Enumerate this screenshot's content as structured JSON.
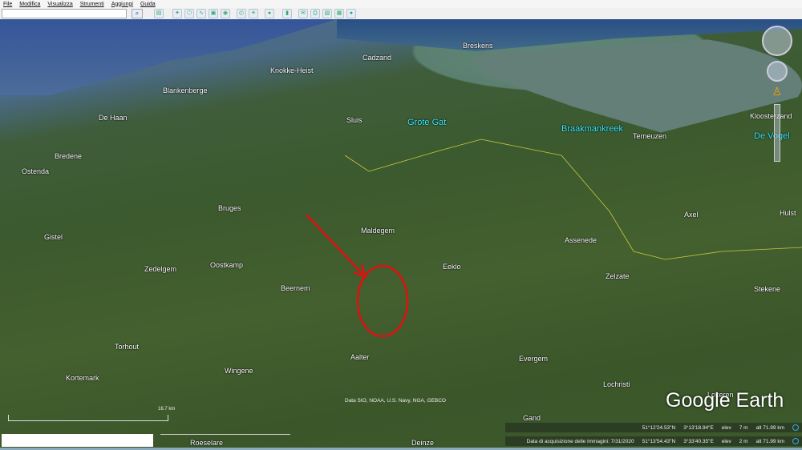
{
  "menu": [
    "File",
    "Modifica",
    "Visualizza",
    "Strumenti",
    "Aggiungi",
    "Guida"
  ],
  "search": {
    "value": "",
    "placeholder": ""
  },
  "toolbar_icons": [
    "sidebar-icon",
    "placemark-icon",
    "polygon-icon",
    "path-icon",
    "overlay-icon",
    "tour-icon",
    "historical-imagery-icon",
    "sunlight-icon",
    "planets-icon",
    "ruler-icon",
    "email-icon",
    "print-icon",
    "save-image-icon",
    "maps-icon",
    "earth-icon"
  ],
  "map": {
    "places": [
      {
        "name": "Cadzand",
        "t": "n"
      },
      {
        "name": "Breskens",
        "t": "n"
      },
      {
        "name": "Knokke-Heist",
        "t": "n"
      },
      {
        "name": "Blankenberge",
        "t": "n"
      },
      {
        "name": "De Haan",
        "t": "n"
      },
      {
        "name": "Bredene",
        "t": "n"
      },
      {
        "name": "Ostenda",
        "t": "n"
      },
      {
        "name": "Sluis",
        "t": "n"
      },
      {
        "name": "Grote Gat",
        "t": "c"
      },
      {
        "name": "Braakmankreek",
        "t": "c"
      },
      {
        "name": "Terneuzen",
        "t": "n"
      },
      {
        "name": "Kloosterzand",
        "t": "n"
      },
      {
        "name": "De Vogel",
        "t": "c"
      },
      {
        "name": "Bruges",
        "t": "n"
      },
      {
        "name": "Maldegem",
        "t": "n"
      },
      {
        "name": "Assenede",
        "t": "n"
      },
      {
        "name": "Axel",
        "t": "n"
      },
      {
        "name": "Hulst",
        "t": "n"
      },
      {
        "name": "Gistel",
        "t": "n"
      },
      {
        "name": "Zedelgem",
        "t": "n"
      },
      {
        "name": "Oostkamp",
        "t": "n"
      },
      {
        "name": "Beernem",
        "t": "n"
      },
      {
        "name": "Eeklo",
        "t": "n"
      },
      {
        "name": "Zelzate",
        "t": "n"
      },
      {
        "name": "Stekene",
        "t": "n"
      },
      {
        "name": "Torhout",
        "t": "n"
      },
      {
        "name": "Aalter",
        "t": "n"
      },
      {
        "name": "Wingene",
        "t": "n"
      },
      {
        "name": "Evergem",
        "t": "n"
      },
      {
        "name": "Kortemark",
        "t": "n"
      },
      {
        "name": "Lochristi",
        "t": "n"
      },
      {
        "name": "Lokeren",
        "t": "n"
      },
      {
        "name": "Gand",
        "t": "n"
      },
      {
        "name": "Roeselare",
        "t": "n"
      },
      {
        "name": "Deinze",
        "t": "n"
      }
    ],
    "attribution": "Data SIO, NOAA, U.S. Navy, NGA, GEBCO",
    "scale": "16.7 km",
    "logo": "Google Earth"
  },
  "status": [
    {
      "date": "",
      "lat": "51°12'24.53\"N",
      "lon": "3°13'18.94\"E",
      "elev_label": "elev",
      "elev": "7 m",
      "alt": "alt  71.99 km"
    },
    {
      "date": "Data di acquisizione delle immagini: 7/31/2020",
      "lat": "51°13'54.43\"N",
      "lon": "3°33'40.35\"E",
      "elev_label": "elev",
      "elev": "2 m",
      "alt": "alt  71.99 km"
    }
  ]
}
